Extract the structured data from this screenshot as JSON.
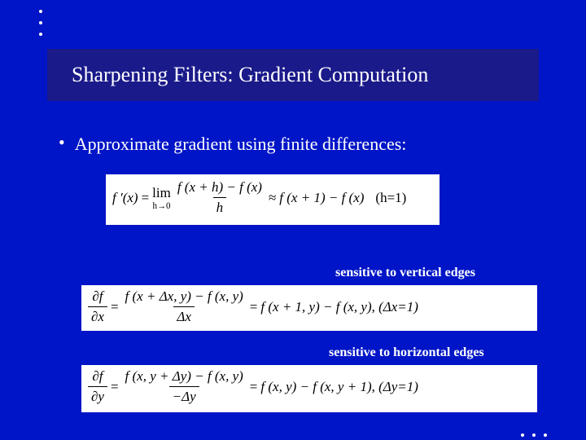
{
  "decor": {
    "bullet": "•"
  },
  "title": "Sharpening Filters: Gradient Computation",
  "bullet1": "Approximate gradient using finite differences:",
  "eq1": {
    "lhs": "f ′(x)",
    "eq": "=",
    "lim_top": "lim",
    "lim_bot": "h→0",
    "frac_num": "f (x + h) − f (x)",
    "frac_den": "h",
    "approx": "≈",
    "rhs": "f (x + 1) − f (x)",
    "cond": "(h=1)"
  },
  "caption_v": "sensitive to vertical edges",
  "eq2": {
    "d_num": "∂f",
    "d_den": "∂x",
    "eq": "=",
    "frac_num": "f (x + Δx, y) − f (x, y)",
    "frac_den": "Δx",
    "rhs_eq": "=",
    "rhs": "f (x + 1, y) − f (x, y), (Δx=1)"
  },
  "dx_label": "Δx",
  "caption_h": "sensitive to horizontal edges",
  "eq3": {
    "d_num": "∂f",
    "d_den": "∂y",
    "eq": "=",
    "frac_num": "f (x, y + Δy) − f (x, y)",
    "frac_den": "−Δy",
    "rhs_eq": "=",
    "rhs": "f (x, y) − f (x, y + 1), (Δy=1)"
  }
}
